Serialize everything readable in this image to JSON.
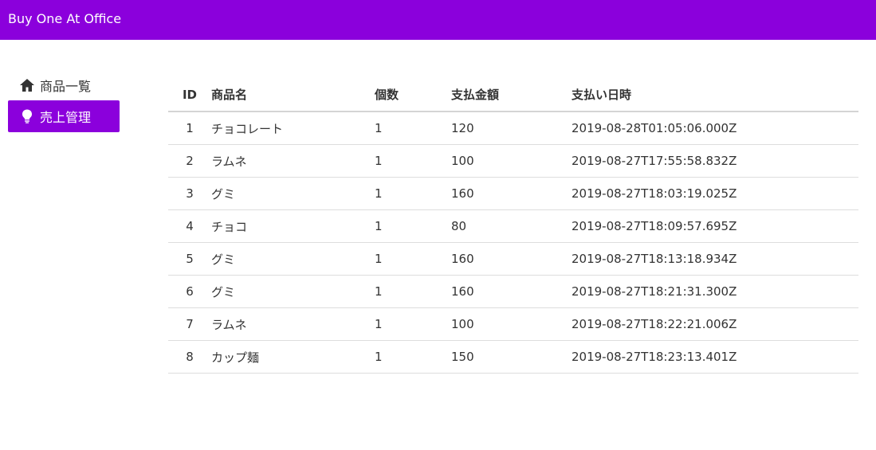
{
  "header": {
    "title": "Buy One At Office"
  },
  "sidebar": {
    "items": [
      {
        "label": "商品一覧",
        "icon": "home-icon",
        "active": false
      },
      {
        "label": "売上管理",
        "icon": "lightbulb-icon",
        "active": true
      }
    ]
  },
  "table": {
    "columns": {
      "id": "ID",
      "name": "商品名",
      "qty": "個数",
      "amount": "支払金額",
      "date": "支払い日時"
    },
    "rows": [
      {
        "id": "1",
        "name": "チョコレート",
        "qty": "1",
        "amount": "120",
        "date": "2019-08-28T01:05:06.000Z"
      },
      {
        "id": "2",
        "name": "ラムネ",
        "qty": "1",
        "amount": "100",
        "date": "2019-08-27T17:55:58.832Z"
      },
      {
        "id": "3",
        "name": "グミ",
        "qty": "1",
        "amount": "160",
        "date": "2019-08-27T18:03:19.025Z"
      },
      {
        "id": "4",
        "name": "チョコ",
        "qty": "1",
        "amount": "80",
        "date": "2019-08-27T18:09:57.695Z"
      },
      {
        "id": "5",
        "name": "グミ",
        "qty": "1",
        "amount": "160",
        "date": "2019-08-27T18:13:18.934Z"
      },
      {
        "id": "6",
        "name": "グミ",
        "qty": "1",
        "amount": "160",
        "date": "2019-08-27T18:21:31.300Z"
      },
      {
        "id": "7",
        "name": "ラムネ",
        "qty": "1",
        "amount": "100",
        "date": "2019-08-27T18:22:21.006Z"
      },
      {
        "id": "8",
        "name": "カップ麺",
        "qty": "1",
        "amount": "150",
        "date": "2019-08-27T18:23:13.401Z"
      }
    ]
  },
  "colors": {
    "accent": "#8b00dc",
    "text": "#333333",
    "divider": "#dddddd"
  }
}
